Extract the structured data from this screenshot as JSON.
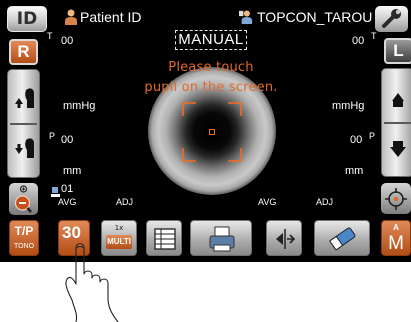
{
  "topbar": {
    "id_button": "ID",
    "patient_label": "Patient ID",
    "operator_name": "TOPCON_TAROU"
  },
  "eye_select": {
    "right": "R",
    "left": "L"
  },
  "status": {
    "mode": "MANUAL",
    "prompt_line1": "Please touch",
    "prompt_line2": "pupil on the screen."
  },
  "right_eye": {
    "t_marker": "T",
    "iop_value": "00",
    "iop_unit": "mmHg",
    "p_marker": "P",
    "p_value": "00",
    "p_unit": "mm",
    "count": "01",
    "avg_label": "AVG",
    "adj_label": "ADJ"
  },
  "left_eye": {
    "t_marker": "T",
    "iop_value": "00",
    "iop_unit": "mmHg",
    "p_marker": "P",
    "p_value": "00",
    "p_unit": "mm",
    "avg_label": "AVG",
    "adj_label": "ADJ"
  },
  "toolbar": {
    "tp_label": "T/P",
    "tp_sub": "TONO",
    "value_30": "30",
    "multi_tag": "1x",
    "multi_label": "MULTI",
    "mode_tag": "A",
    "mode_label": "M"
  },
  "colors": {
    "accent_orange": "#b24d16",
    "prompt_orange": "#e06a2c",
    "screen_bg": "#000000"
  },
  "icons": [
    "patient-icon",
    "operator-icon",
    "wrench-icon",
    "chinrest-up-icon",
    "chinrest-down-icon",
    "zoom-out-icon",
    "target-icon",
    "list-icon",
    "printer-icon",
    "eraser-icon",
    "reticle-icon",
    "hand-pointer-icon"
  ]
}
